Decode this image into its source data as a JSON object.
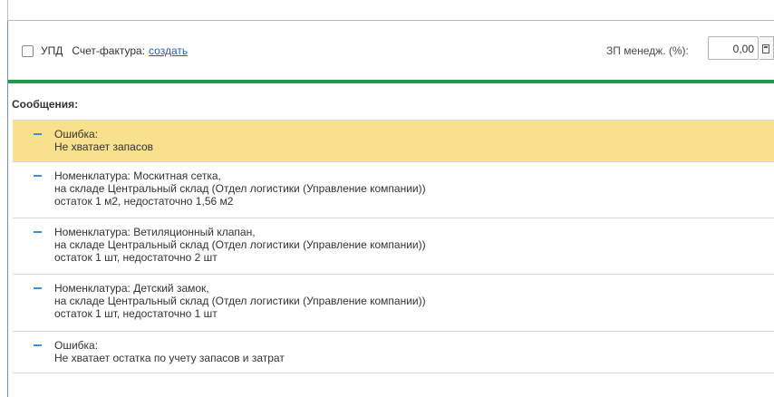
{
  "form": {
    "upd_label": "УПД",
    "invoice_label": "Счет-фактура:",
    "invoice_link": "создать",
    "zp_label": "ЗП менедж. (%):",
    "zp_value": "0,00"
  },
  "messages": {
    "header": "Сообщения:",
    "items": [
      {
        "highlighted": true,
        "lines": [
          "Ошибка:",
          "Не хватает запасов"
        ]
      },
      {
        "highlighted": false,
        "lines": [
          "Номенклатура: Москитная сетка,",
          "на складе Центральный склад (Отдел логистики (Управление компании))",
          "остаток 1 м2, недостаточно 1,56 м2"
        ]
      },
      {
        "highlighted": false,
        "lines": [
          "Номенклатура: Ветиляционный клапан,",
          "на складе Центральный склад (Отдел логистики (Управление компании))",
          "остаток 1 шт, недостаточно 2 шт"
        ]
      },
      {
        "highlighted": false,
        "lines": [
          "Номенклатура: Детский замок,",
          "на складе Центральный склад (Отдел логистики (Управление компании))",
          "остаток 1 шт, недостаточно 1 шт"
        ]
      },
      {
        "highlighted": false,
        "lines": [
          "Ошибка:",
          "Не хватает остатка по учету запасов и затрат"
        ]
      }
    ]
  },
  "colors": {
    "accent_green": "#1c9a47",
    "highlight_yellow": "#f8e08d",
    "link_blue": "#1f5fb5",
    "dash_blue": "#3d8fd6"
  },
  "icons": {
    "calculator": "calculator-icon",
    "collapse": "minus-icon"
  }
}
